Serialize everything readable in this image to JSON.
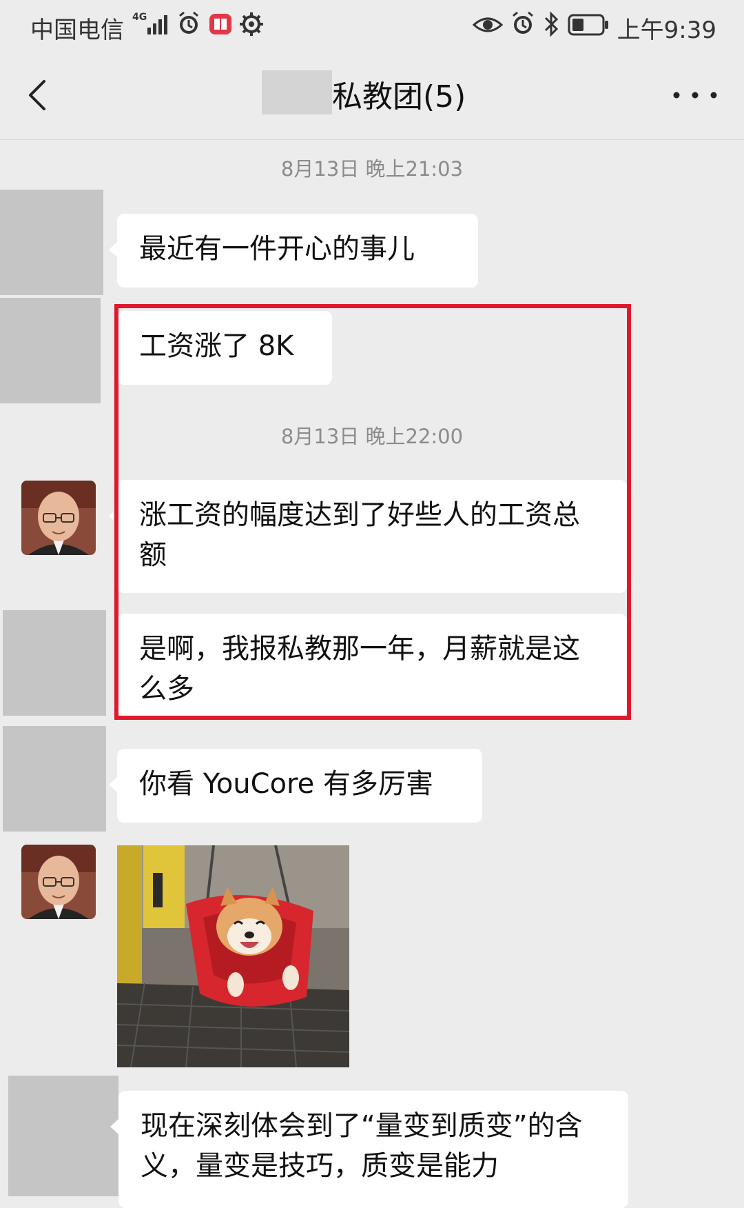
{
  "status_bar": {
    "carrier": "中国电信",
    "network_badge": "4G",
    "time": "上午9:39"
  },
  "header": {
    "title": "私教团(5)",
    "back_icon": "chevron-left-icon",
    "more_icon": "more-dots-icon"
  },
  "messages": {
    "ts1": "8月13日 晚上21:03",
    "m1": "最近有一件开心的事儿",
    "m2": "工资涨了 8K",
    "ts2": "8月13日 晚上22:00",
    "m3": "涨工资的幅度达到了好些人的工资总额",
    "m4": "是啊，我报私教那一年，月薪就是这么多",
    "m5": "你看 YouCore 有多厉害",
    "m6": "现在深刻体会到了“量变到质变”的含义，量变是技巧，质变是能力"
  },
  "colors": {
    "background": "#ececec",
    "bubble": "#ffffff",
    "highlight_border": "#e0182d",
    "timestamp_text": "#8b8b8b"
  }
}
